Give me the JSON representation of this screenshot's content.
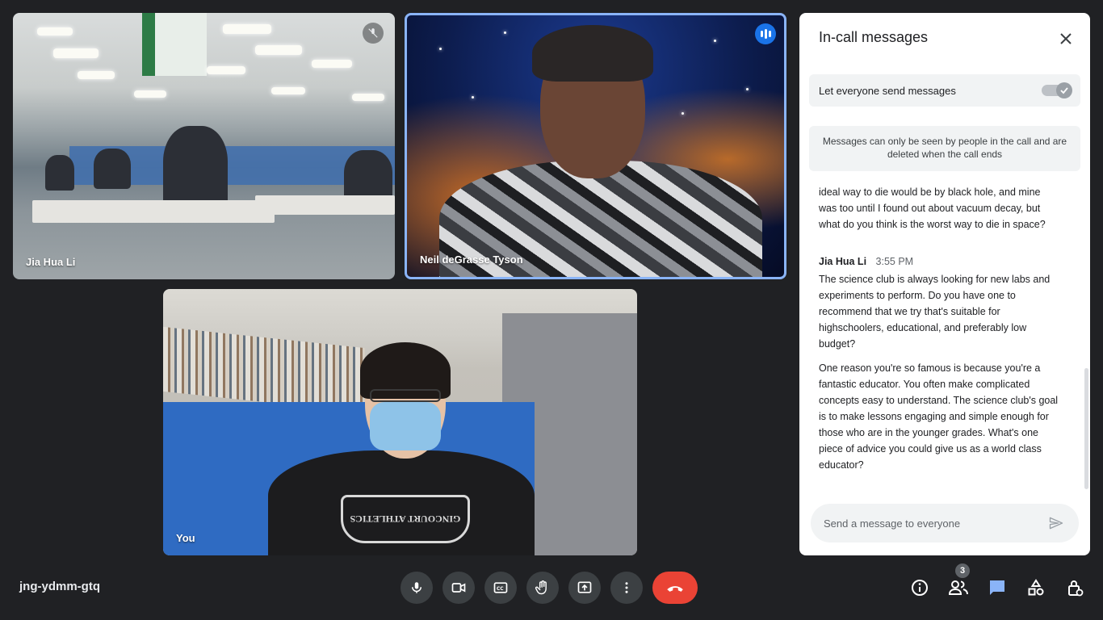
{
  "tiles": {
    "top_left": {
      "name": "Jia Hua Li",
      "muted": true
    },
    "top_right": {
      "name": "Neil deGrasse Tyson",
      "speaking": true
    },
    "bottom": {
      "name": "You",
      "shirt_text": "GINCOURT ATHLETICS"
    }
  },
  "chat": {
    "title": "In-call messages",
    "toggle_label": "Let everyone send messages",
    "toggle_on": true,
    "notice": "Messages can only be seen by people in the call and are deleted when the call ends",
    "messages": [
      {
        "text": "ideal way to die would be by black hole, and mine was too until I found out about vacuum decay, but what do you think is the worst way to die in space?"
      },
      {
        "sender": "Jia Hua Li",
        "time": "3:55 PM",
        "text": "The science club is always looking for new labs  and experiments to perform. Do you have one to recommend that we try that's suitable for highschoolers, educational, and preferably low budget?"
      },
      {
        "text": "One reason you're so famous is because you're a fantastic educator. You often make complicated concepts easy to understand. The science club's goal is to make lessons engaging and simple enough for those who are in the younger grades. What's one piece of advice you could give us as a world class educator?"
      }
    ],
    "composer_placeholder": "Send a message to everyone"
  },
  "bottom_bar": {
    "meeting_code": "jng-ydmm-gtq",
    "controls": [
      "mic-icon",
      "camera-icon",
      "captions-icon",
      "raise-hand-icon",
      "present-icon",
      "more-options-icon",
      "end-call-icon"
    ],
    "right_icons": [
      "info-icon",
      "people-icon",
      "chat-icon",
      "activities-icon",
      "host-controls-icon"
    ],
    "people_count": "3"
  },
  "colors": {
    "background": "#202124",
    "accent_blue": "#8ab4f8",
    "end_call_red": "#ea4335",
    "chat_active": "#8ab4f8"
  }
}
